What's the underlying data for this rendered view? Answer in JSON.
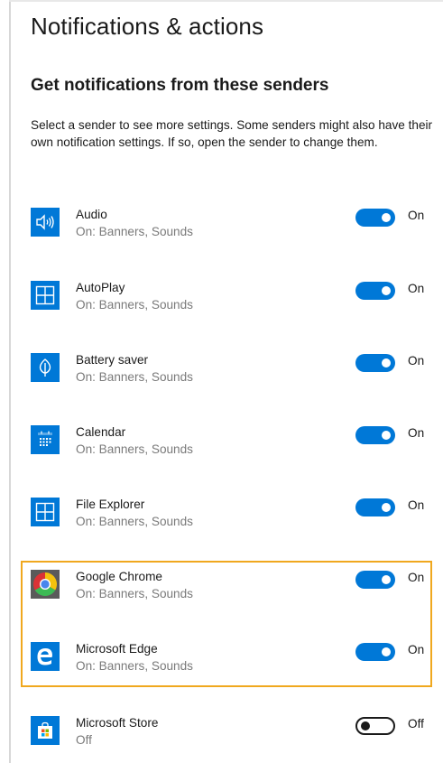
{
  "page": {
    "title": "Notifications & actions",
    "section_title": "Get notifications from these senders",
    "description": "Select a sender to see more settings. Some senders might also have their own notification settings. If so, open the sender to change them."
  },
  "senders": [
    {
      "name": "Audio",
      "status": "On: Banners, Sounds",
      "toggle": "On",
      "enabled": true,
      "icon": "speaker-icon"
    },
    {
      "name": "AutoPlay",
      "status": "On: Banners, Sounds",
      "toggle": "On",
      "enabled": true,
      "icon": "autoplay-icon"
    },
    {
      "name": "Battery saver",
      "status": "On: Banners, Sounds",
      "toggle": "On",
      "enabled": true,
      "icon": "battery-saver-icon"
    },
    {
      "name": "Calendar",
      "status": "On: Banners, Sounds",
      "toggle": "On",
      "enabled": true,
      "icon": "calendar-icon"
    },
    {
      "name": "File Explorer",
      "status": "On: Banners, Sounds",
      "toggle": "On",
      "enabled": true,
      "icon": "file-explorer-icon"
    },
    {
      "name": "Google Chrome",
      "status": "On: Banners, Sounds",
      "toggle": "On",
      "enabled": true,
      "icon": "chrome-icon"
    },
    {
      "name": "Microsoft Edge",
      "status": "On: Banners, Sounds",
      "toggle": "On",
      "enabled": true,
      "icon": "edge-icon"
    },
    {
      "name": "Microsoft Store",
      "status": "Off",
      "toggle": "Off",
      "enabled": false,
      "icon": "store-icon"
    }
  ],
  "colors": {
    "accent": "#0078d7",
    "highlight": "#f0a81e"
  }
}
